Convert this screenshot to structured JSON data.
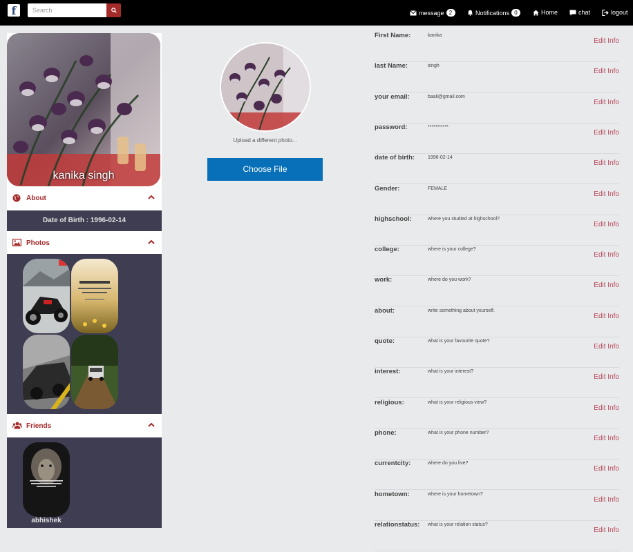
{
  "header": {
    "logo": "f",
    "search_placeholder": "Search",
    "nav": {
      "message_label": "message",
      "message_count": "2",
      "notifications_label": "Notifications",
      "notifications_count": "0",
      "home_label": "Home",
      "chat_label": "chat",
      "logout_label": "logout"
    }
  },
  "profile": {
    "name": "kanika singh",
    "about": {
      "title": "About",
      "dob_text": "Date of Birth : 1996-02-14"
    },
    "photos": {
      "title": "Photos"
    },
    "friends": {
      "title": "Friends",
      "items": [
        {
          "name": "abhishek"
        }
      ]
    }
  },
  "upload": {
    "label": "Upload a different photo...",
    "button": "Choose File"
  },
  "info": {
    "edit_label": "Edit Info",
    "fields": [
      {
        "label": "First Name:",
        "value": "kanika"
      },
      {
        "label": "last Name:",
        "value": "singh"
      },
      {
        "label": "your email:",
        "value": "baali@gmail.com"
      },
      {
        "label": "password:",
        "value": "***********"
      },
      {
        "label": "date of birth:",
        "value": "1996-02-14"
      },
      {
        "label": "Gender:",
        "value": "FEMALE"
      },
      {
        "label": "highschool:",
        "value": "where you studied at highschool?"
      },
      {
        "label": "college:",
        "value": "where is your college?"
      },
      {
        "label": "work:",
        "value": "where do you work?"
      },
      {
        "label": "about:",
        "value": "write something about yourself."
      },
      {
        "label": "quote:",
        "value": "what is your favourite quote?"
      },
      {
        "label": "interest:",
        "value": "what is your interest?"
      },
      {
        "label": "religious:",
        "value": "what is your religious view?"
      },
      {
        "label": "phone:",
        "value": "what is your phone number?"
      },
      {
        "label": "currentcity:",
        "value": "where do you live?"
      },
      {
        "label": "hometown:",
        "value": "where is your hometown?"
      },
      {
        "label": "relationstatus:",
        "value": "what is your relation status?"
      }
    ]
  },
  "colors": {
    "topbar": "#000000",
    "accent": "#a52a2a",
    "button": "#0870b8",
    "panel": "#3f3d52",
    "edit_link": "#b5485a"
  },
  "icons": [
    "search-icon",
    "envelope-icon",
    "bell-icon",
    "home-icon",
    "comment-icon",
    "logout-icon",
    "globe-icon",
    "image-icon",
    "users-icon",
    "chevron-up-icon"
  ]
}
